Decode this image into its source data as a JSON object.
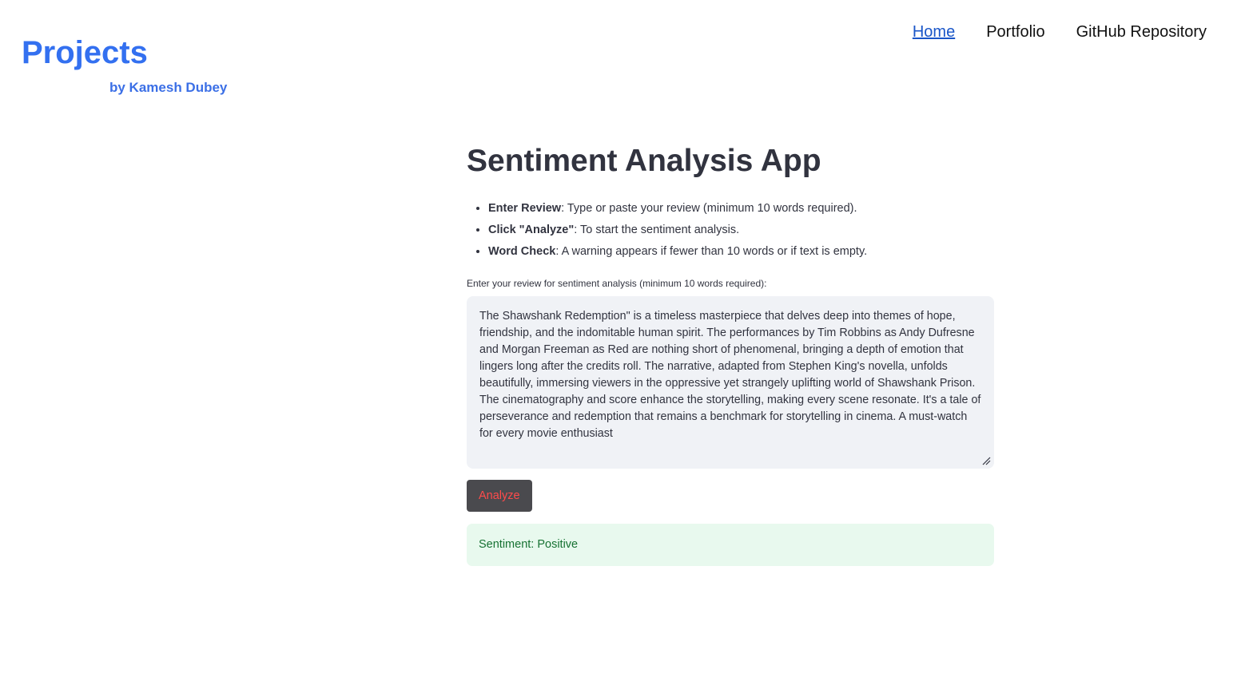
{
  "brand": {
    "title": "Projects",
    "subtitle": "by Kamesh Dubey"
  },
  "nav": {
    "items": [
      {
        "label": "Home",
        "active": true
      },
      {
        "label": "Portfolio",
        "active": false
      },
      {
        "label": "GitHub Repository",
        "active": false
      }
    ]
  },
  "main": {
    "title": "Sentiment Analysis App",
    "instructions": [
      {
        "bold": "Enter Review",
        "text": ": Type or paste your review (minimum 10 words required)."
      },
      {
        "bold": "Click \"Analyze\"",
        "text": ": To start the sentiment analysis."
      },
      {
        "bold": "Word Check",
        "text": ": A warning appears if fewer than 10 words or if text is empty."
      }
    ],
    "review_label": "Enter your review for sentiment analysis (minimum 10 words required):",
    "review_value": "The Shawshank Redemption\" is a timeless masterpiece that delves deep into themes of hope, friendship, and the indomitable human spirit. The performances by Tim Robbins as Andy Dufresne and Morgan Freeman as Red are nothing short of phenomenal, bringing a depth of emotion that lingers long after the credits roll. The narrative, adapted from Stephen King's novella, unfolds beautifully, immersing viewers in the oppressive yet strangely uplifting world of Shawshank Prison. The cinematography and score enhance the storytelling, making every scene resonate. It's a tale of perseverance and redemption that remains a benchmark for storytelling in cinema. A must-watch for every movie enthusiast",
    "analyze_label": "Analyze",
    "result_text": "Sentiment: Positive"
  },
  "colors": {
    "brand": "#3370f0",
    "button_bg": "#4a4a4e",
    "button_text": "#ff4b4b",
    "success_bg": "#e8f9ee",
    "success_text": "#177233",
    "textarea_bg": "#f0f2f6"
  },
  "icons": {
    "resize_handle": "resize-grip-icon"
  }
}
